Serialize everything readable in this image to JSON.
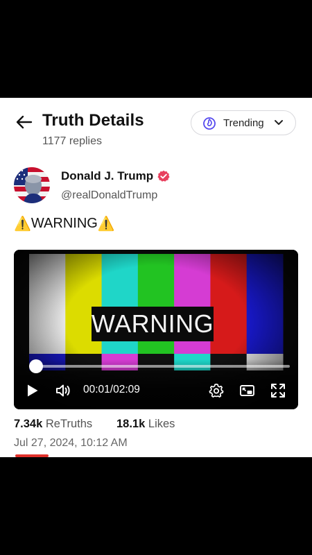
{
  "header": {
    "title": "Truth Details",
    "reply_count": "1177 replies",
    "trending_label": "Trending"
  },
  "post": {
    "author_name": "Donald J. Trump",
    "author_handle": "@realDonaldTrump",
    "text": "WARNING",
    "video": {
      "overlay_text": "WARNING",
      "current_time": "00:01",
      "separator": "/",
      "duration": "02:09",
      "progress": 0.008
    },
    "stats": {
      "retruths_count": "7.34k",
      "retruths_label": "ReTruths",
      "likes_count": "18.1k",
      "likes_label": "Likes"
    },
    "date": "Jul 27, 2024, 10:12 AM"
  },
  "colors": {
    "accent": "#5448ee",
    "verified": "#e8405e",
    "underline": "#e0312b",
    "color_bars": [
      "#e8e8e8",
      "#dcdc00",
      "#1fd6c8",
      "#22c322",
      "#d53cd3",
      "#d61a1a",
      "#1818c8"
    ],
    "lower_bars": [
      "#1818c8",
      "#111111",
      "#d53cd3",
      "#111111",
      "#1fd6c8",
      "#111111",
      "#e8e8e8"
    ]
  },
  "icons": {
    "back": "arrow-left-icon",
    "trending": "flame-icon",
    "dropdown": "chevron-down-icon",
    "verified": "verified-badge-icon",
    "warning": "warning-triangle-icon",
    "play": "play-icon",
    "volume": "volume-icon",
    "settings": "gear-icon",
    "pip": "picture-in-picture-icon",
    "fullscreen": "fullscreen-icon"
  }
}
